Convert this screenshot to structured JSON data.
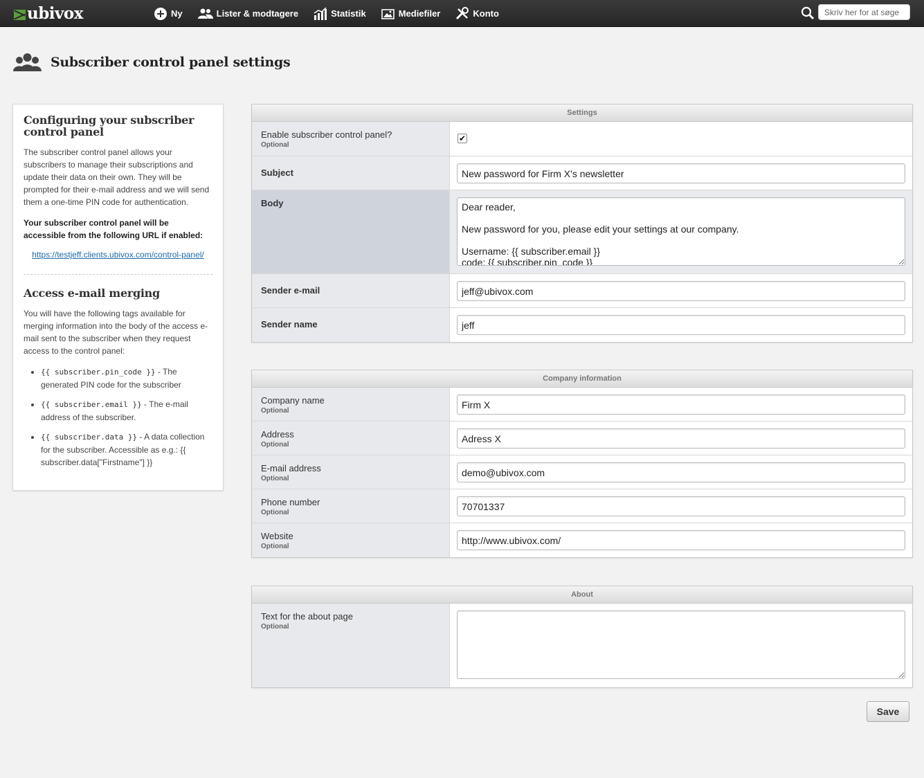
{
  "brand": {
    "name": "ubivox",
    "logo_icon": "envelope-logo-icon",
    "accent": "#5a9e3c"
  },
  "nav": {
    "items": [
      {
        "label": "Ny",
        "icon": "plus-circle-icon"
      },
      {
        "label": "Lister & modtagere",
        "icon": "users-icon"
      },
      {
        "label": "Statistik",
        "icon": "chart-icon"
      },
      {
        "label": "Mediefiler",
        "icon": "image-icon"
      },
      {
        "label": "Konto",
        "icon": "tools-icon"
      }
    ],
    "search_placeholder": "Skriv her for at søge"
  },
  "page": {
    "title": "Subscriber control panel settings",
    "icon": "group-icon"
  },
  "sidebar": {
    "heading1": "Configuring your subscriber control panel",
    "intro": "The subscriber control panel allows your subscribers to manage their subscriptions and update their data on their own. They will be prompted for their e-mail address and we will send them a one-time PIN code for authentication.",
    "url_note": "Your subscriber control panel will be accessible from the following URL if enabled:",
    "url": "https://testjeff.clients.ubivox.com/control-panel/",
    "heading2": "Access e-mail merging",
    "merge_intro": "You will have the following tags available for merging information into the body of the access e-mail sent to the subscriber when they request access to the control panel:",
    "tags": [
      {
        "code": "{{ subscriber.pin_code }}",
        "desc": " - The generated PIN code for the subscriber"
      },
      {
        "code": "{{ subscriber.email }}",
        "desc": " - The e-mail address of the subscriber."
      },
      {
        "code": "{{ subscriber.data }}",
        "desc": " - A data collection for the subscriber. Accessible as e.g.: {{ subscriber.data[\"Firstname\"] }}"
      }
    ]
  },
  "settings": {
    "heading": "Settings",
    "optional_label": "Optional",
    "enable_label": "Enable subscriber control panel?",
    "enable_checked": true,
    "subject_label": "Subject",
    "subject_value": "New password for Firm X's newsletter",
    "body_label": "Body",
    "body_value": "Dear reader,\n\nNew password for you, please edit your settings at our company.\n\nUsername: {{ subscriber.email }}\ncode: {{ subscriber.pin_code }}",
    "sender_email_label": "Sender e-mail",
    "sender_email_value": "jeff@ubivox.com",
    "sender_name_label": "Sender name",
    "sender_name_value": "jeff"
  },
  "company": {
    "heading": "Company information",
    "optional_label": "Optional",
    "fields": [
      {
        "label": "Company name",
        "value": "Firm X"
      },
      {
        "label": "Address",
        "value": "Adress X"
      },
      {
        "label": "E-mail address",
        "value": "demo@ubivox.com"
      },
      {
        "label": "Phone number",
        "value": "70701337"
      },
      {
        "label": "Website",
        "value": "http://www.ubivox.com/"
      }
    ]
  },
  "about": {
    "heading": "About",
    "optional_label": "Optional",
    "text_label": "Text for the about page",
    "text_value": ""
  },
  "actions": {
    "save_label": "Save"
  }
}
